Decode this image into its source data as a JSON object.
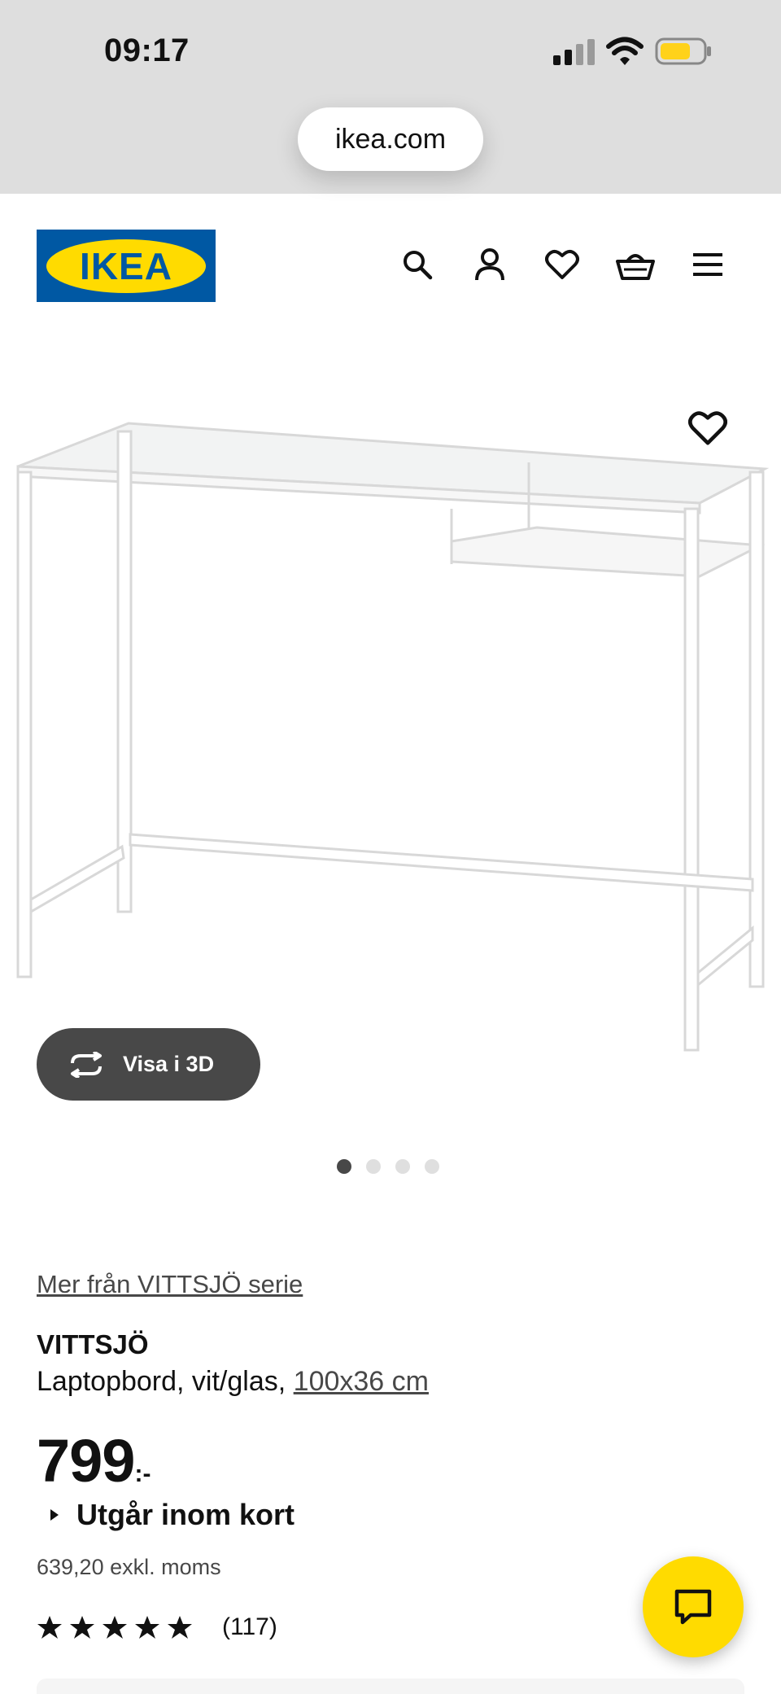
{
  "status_bar": {
    "time": "09:17"
  },
  "browser": {
    "url": "ikea.com"
  },
  "header": {
    "logo_text": "IKEA",
    "icons": [
      "search-icon",
      "account-icon",
      "heart-icon",
      "basket-icon",
      "menu-icon"
    ]
  },
  "gallery": {
    "view_3d_label": "Visa i 3D",
    "image_count": 4,
    "active_index": 0
  },
  "product": {
    "series_link": "Mer från VITTSJÖ serie",
    "name": "VITTSJÖ",
    "description": "Laptopbord, vit/glas, ",
    "size": "100x36 cm",
    "price": "799",
    "price_suffix": ":-",
    "availability": "Utgår inom kort",
    "price_excl_vat": "639,20 exkl. moms",
    "rating_stars": 5,
    "review_count": "(117)"
  },
  "colors": {
    "ikea_blue": "#0058a3",
    "ikea_yellow": "#ffdb00",
    "dark_button": "#484848"
  }
}
